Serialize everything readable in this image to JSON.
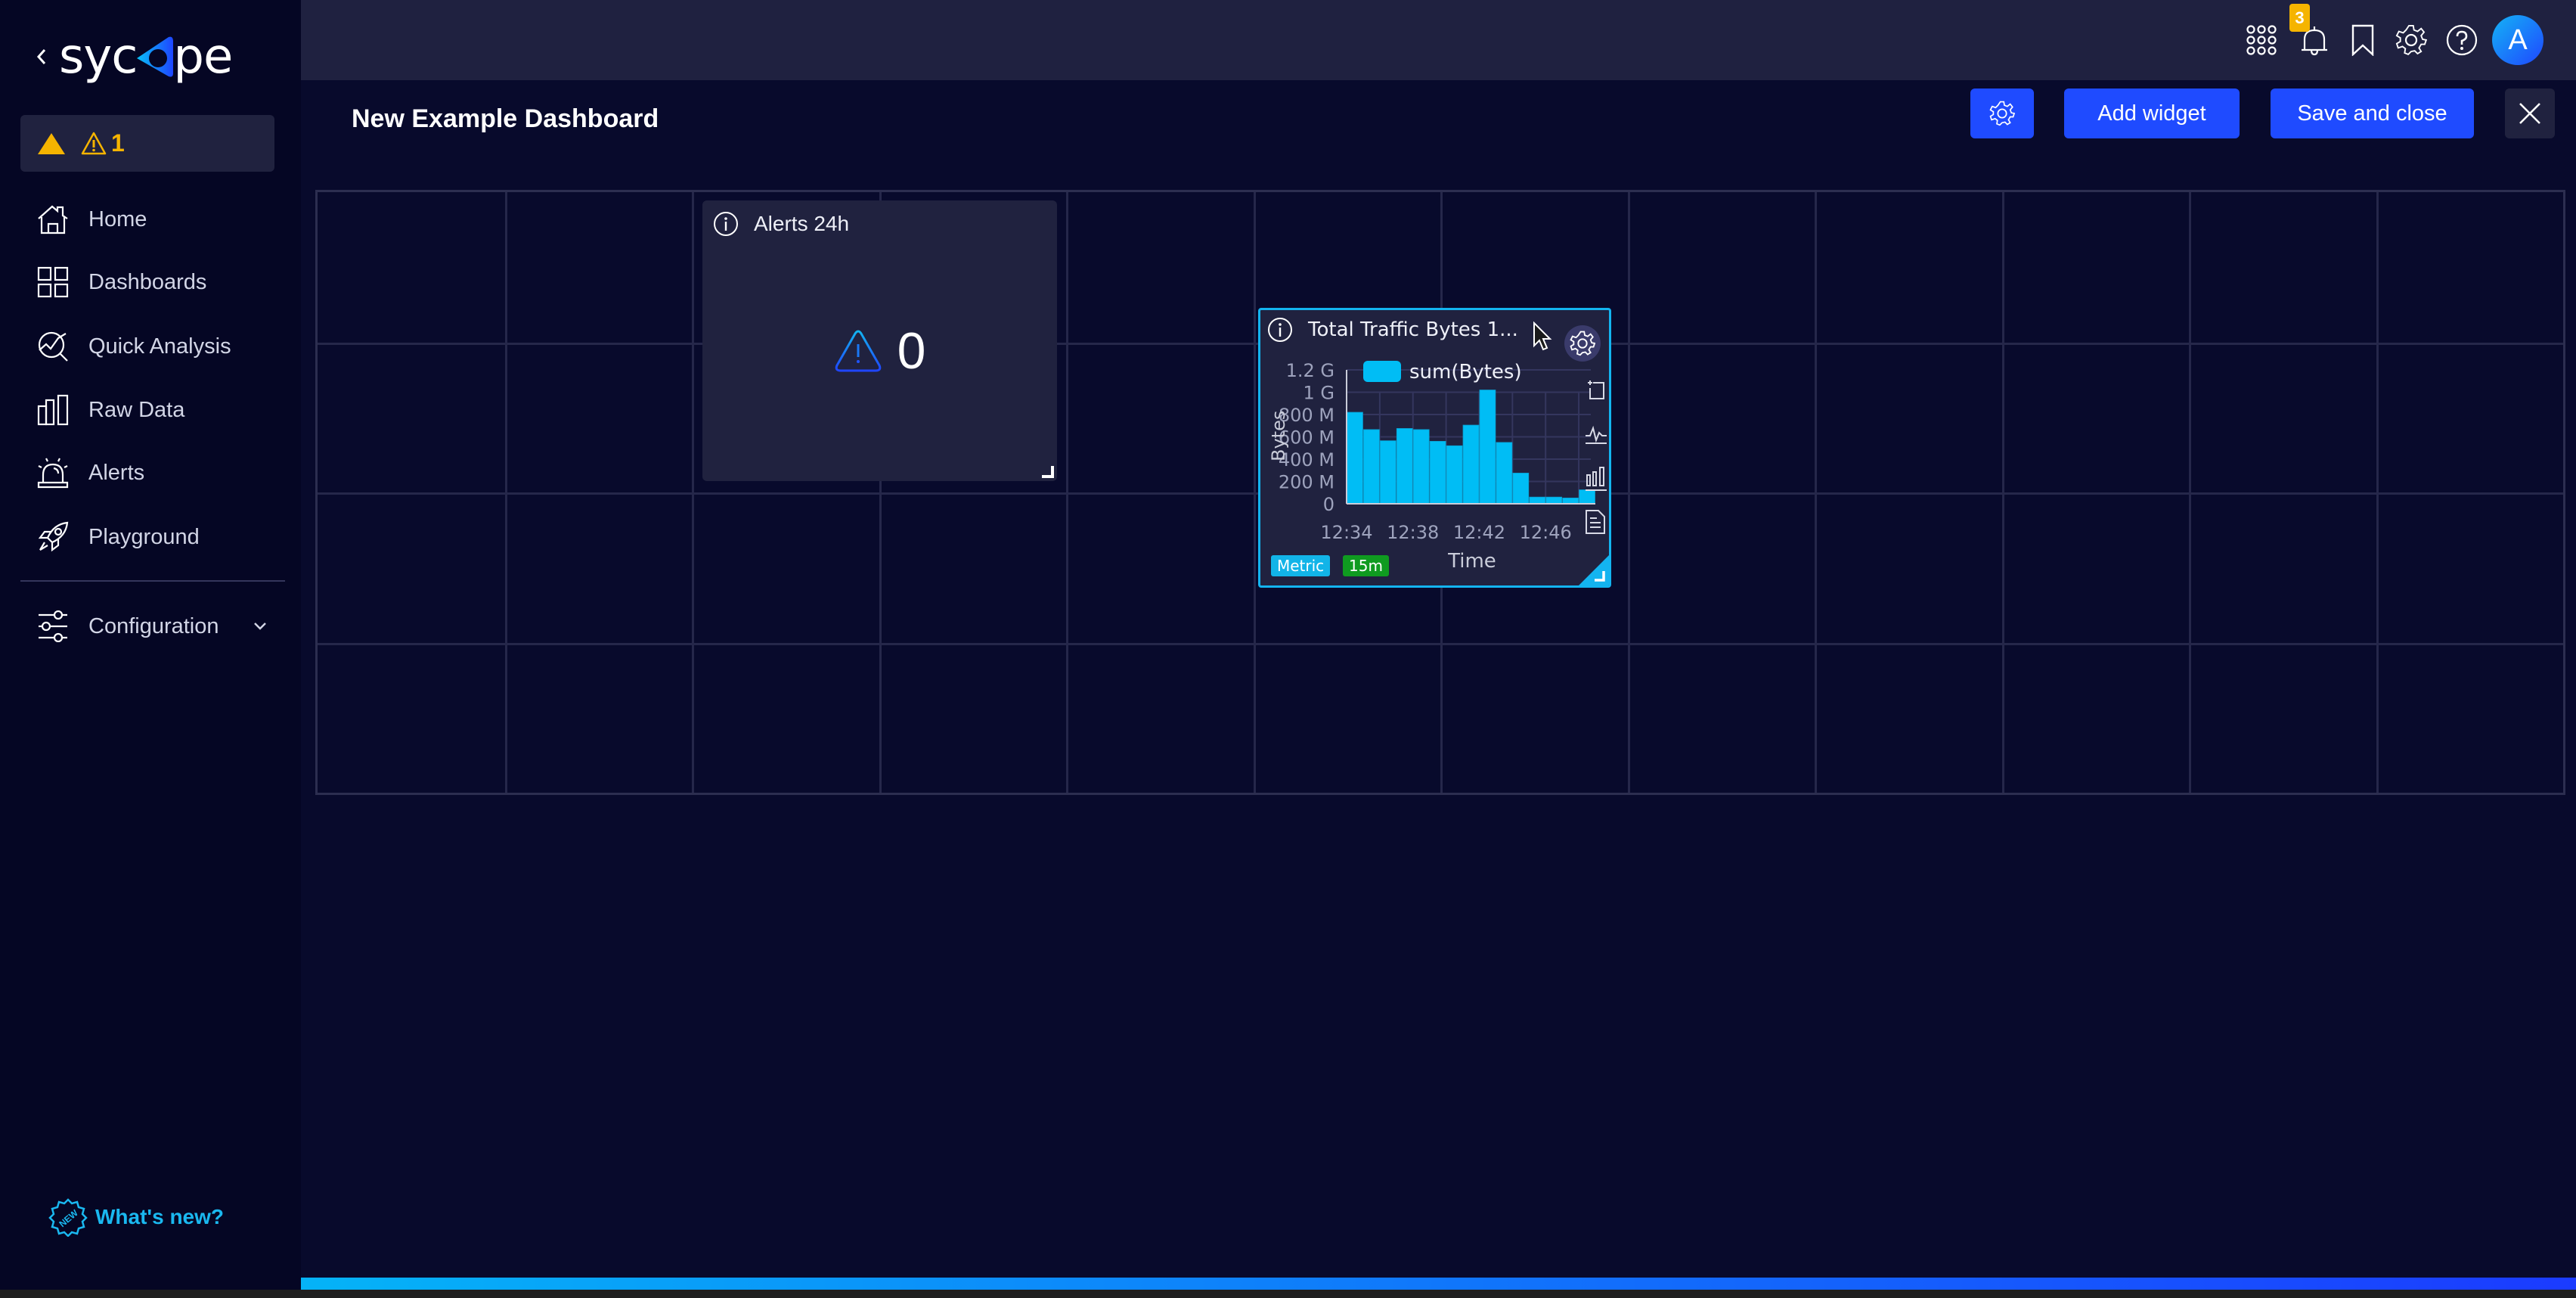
{
  "app": {
    "brand": "sycope",
    "collapse_icon": "chevron-left-icon"
  },
  "sidebar": {
    "alert_summary": {
      "count": "1",
      "icons": [
        "warning-solid-icon",
        "warning-outline-icon"
      ],
      "color": "#f5b400"
    },
    "items": [
      {
        "label": "Home",
        "icon": "home-icon"
      },
      {
        "label": "Dashboards",
        "icon": "dashboards-icon"
      },
      {
        "label": "Quick Analysis",
        "icon": "quick-analysis-icon"
      },
      {
        "label": "Raw Data",
        "icon": "raw-data-icon"
      },
      {
        "label": "Alerts",
        "icon": "siren-icon"
      },
      {
        "label": "Playground",
        "icon": "rocket-icon"
      }
    ],
    "configuration": {
      "label": "Configuration",
      "icon": "sliders-icon",
      "expand_icon": "chevron-down-icon"
    },
    "whats_new": {
      "label": "What's new?",
      "icon": "new-badge-icon",
      "badge_text": "NEW"
    }
  },
  "topbar": {
    "icons": [
      "apps-grid-icon",
      "bell-icon",
      "bookmark-icon",
      "settings-icon",
      "help-icon"
    ],
    "notification_count": "3",
    "avatar_initial": "A"
  },
  "toolbar": {
    "page_title": "New Example Dashboard",
    "settings_icon": "gear-icon",
    "add_widget_label": "Add widget",
    "save_close_label": "Save and close",
    "close_icon": "close-icon"
  },
  "grid": {
    "columns": 12,
    "rows": 4
  },
  "widgets": {
    "alerts": {
      "title": "Alerts 24h",
      "value": "0"
    },
    "traffic": {
      "title": "Total Traffic Bytes 1...",
      "tags": [
        {
          "label": "Metric",
          "color": "#12b4e8"
        },
        {
          "label": "15m",
          "color": "#0f9b20"
        }
      ],
      "tools": [
        "zoom-select-icon",
        "line-chart-icon",
        "bar-chart-icon",
        "document-icon"
      ]
    }
  },
  "progress": {
    "value_percent": 100,
    "color_start": "#05b3f7",
    "color_end": "#1b3bff"
  },
  "chart_data": {
    "type": "bar",
    "title": "Total Traffic Bytes 1...",
    "xlabel": "Time",
    "ylabel": "Bytes",
    "legend": [
      "sum(Bytes)"
    ],
    "legend_position": "top",
    "series": [
      {
        "name": "sum(Bytes)",
        "color": "#00bdf5",
        "values": [
          820000000,
          665000000,
          565000000,
          675000000,
          665000000,
          560000000,
          520000000,
          705000000,
          1020000000,
          550000000,
          275000000,
          60000000,
          60000000,
          52000000,
          125000000
        ]
      }
    ],
    "x_tick_labels": [
      "12:34",
      "12:38",
      "12:42",
      "12:46"
    ],
    "x_tick_indices": [
      0,
      4,
      8,
      12
    ],
    "y_tick_labels": [
      "0",
      "200 M",
      "400 M",
      "600 M",
      "800 M",
      "1 G",
      "1.2 G"
    ],
    "y_tick_values": [
      0,
      200000000,
      400000000,
      600000000,
      800000000,
      1000000000,
      1200000000
    ],
    "ylim": [
      0,
      1200000000
    ],
    "grid": true
  }
}
